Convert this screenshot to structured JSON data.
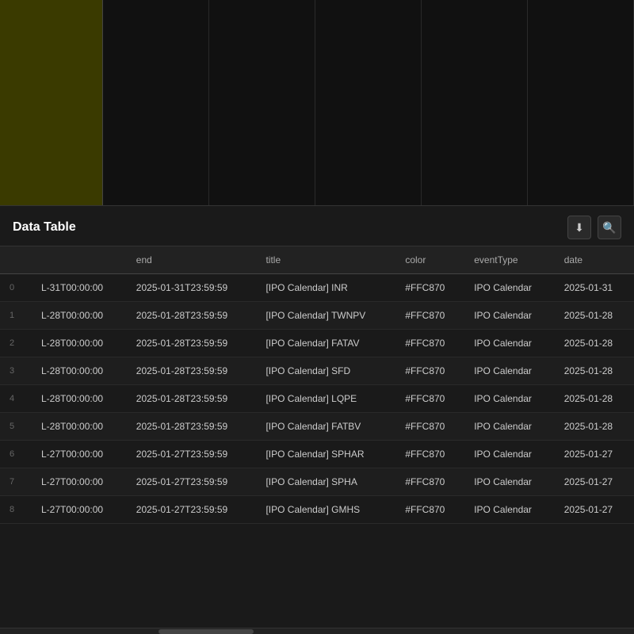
{
  "chart": {
    "left_block_color": "#3a3a00",
    "columns": 6
  },
  "data_table": {
    "title": "Data Table",
    "actions": {
      "download_label": "⬇",
      "search_label": "🔍"
    },
    "columns": [
      {
        "key": "row_num",
        "label": ""
      },
      {
        "key": "start",
        "label": ""
      },
      {
        "key": "end",
        "label": "end"
      },
      {
        "key": "title",
        "label": "title"
      },
      {
        "key": "color",
        "label": "color"
      },
      {
        "key": "eventType",
        "label": "eventType"
      },
      {
        "key": "date",
        "label": "date"
      }
    ],
    "rows": [
      {
        "row_num": "0",
        "start": "L-31T00:00:00",
        "end": "2025-01-31T23:59:59",
        "title": "[IPO Calendar] INR",
        "color": "#FFC870",
        "eventType": "IPO Calendar",
        "date": "2025-01-31"
      },
      {
        "row_num": "1",
        "start": "L-28T00:00:00",
        "end": "2025-01-28T23:59:59",
        "title": "[IPO Calendar] TWNPV",
        "color": "#FFC870",
        "eventType": "IPO Calendar",
        "date": "2025-01-28"
      },
      {
        "row_num": "2",
        "start": "L-28T00:00:00",
        "end": "2025-01-28T23:59:59",
        "title": "[IPO Calendar] FATAV",
        "color": "#FFC870",
        "eventType": "IPO Calendar",
        "date": "2025-01-28"
      },
      {
        "row_num": "3",
        "start": "L-28T00:00:00",
        "end": "2025-01-28T23:59:59",
        "title": "[IPO Calendar] SFD",
        "color": "#FFC870",
        "eventType": "IPO Calendar",
        "date": "2025-01-28"
      },
      {
        "row_num": "4",
        "start": "L-28T00:00:00",
        "end": "2025-01-28T23:59:59",
        "title": "[IPO Calendar] LQPE",
        "color": "#FFC870",
        "eventType": "IPO Calendar",
        "date": "2025-01-28"
      },
      {
        "row_num": "5",
        "start": "L-28T00:00:00",
        "end": "2025-01-28T23:59:59",
        "title": "[IPO Calendar] FATBV",
        "color": "#FFC870",
        "eventType": "IPO Calendar",
        "date": "2025-01-28"
      },
      {
        "row_num": "6",
        "start": "L-27T00:00:00",
        "end": "2025-01-27T23:59:59",
        "title": "[IPO Calendar] SPHAR",
        "color": "#FFC870",
        "eventType": "IPO Calendar",
        "date": "2025-01-27"
      },
      {
        "row_num": "7",
        "start": "L-27T00:00:00",
        "end": "2025-01-27T23:59:59",
        "title": "[IPO Calendar] SPHA",
        "color": "#FFC870",
        "eventType": "IPO Calendar",
        "date": "2025-01-27"
      },
      {
        "row_num": "8",
        "start": "L-27T00:00:00",
        "end": "2025-01-27T23:59:59",
        "title": "[IPO Calendar] GMHS",
        "color": "#FFC870",
        "eventType": "IPO Calendar",
        "date": "2025-01-27"
      }
    ]
  }
}
